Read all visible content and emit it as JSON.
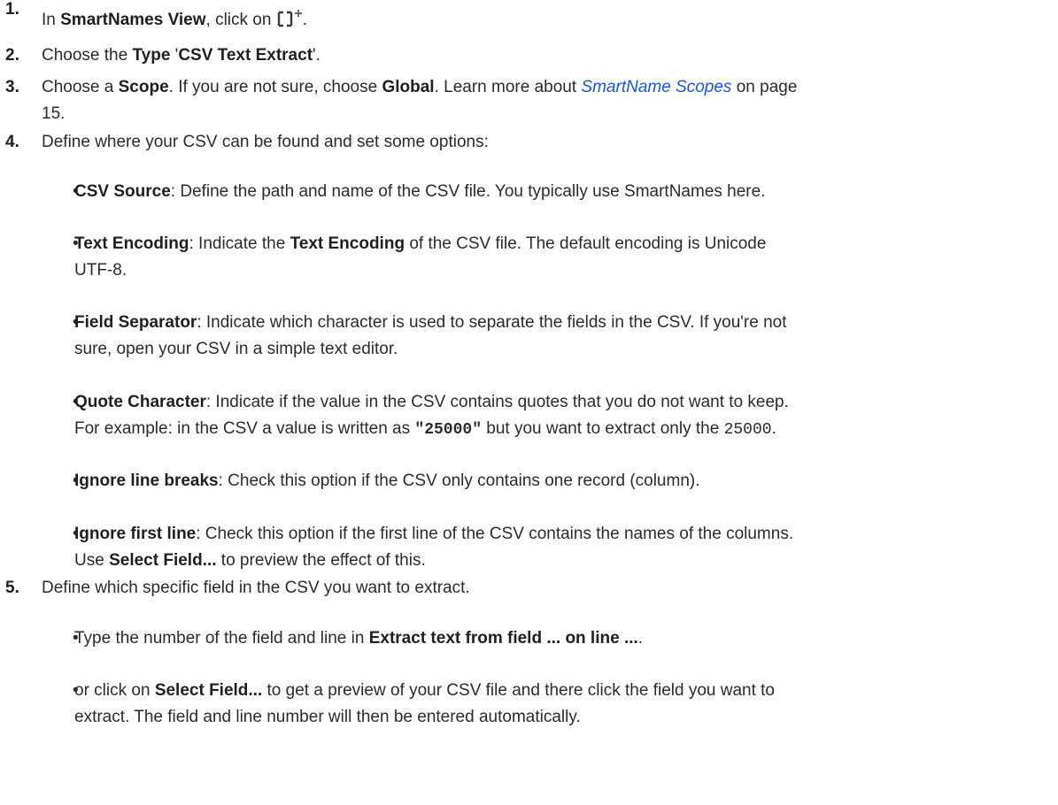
{
  "steps": [
    {
      "num": "1.",
      "parts": [
        "In ",
        "SmartNames View",
        ", click on ",
        "."
      ],
      "icon": "insert-smartname-icon"
    },
    {
      "num": "2.",
      "parts": [
        "Choose the ",
        "Type",
        " '",
        "CSV Text Extract",
        "'."
      ]
    },
    {
      "num": "3.",
      "line1": [
        "Choose a ",
        "Scope",
        ". If you are not sure, choose ",
        "Global",
        ". Learn more about ",
        "SmartName Scopes",
        " on page"
      ],
      "line2": "15."
    },
    {
      "num": "4.",
      "text": "Define where your CSV can be found and set some options:",
      "bullets": [
        {
          "label": "CSV Source",
          "text": ": Define the path and name of the CSV file. You typically use SmartNames here."
        },
        {
          "label": "Text Encoding",
          "text_a": ": Indicate the ",
          "bold_b": "Text Encoding",
          "text_c": " of the CSV file. The default encoding is Unicode",
          "line2": "UTF-8."
        },
        {
          "label": "Field Separator",
          "text": ": Indicate which character is used to separate the fields in the CSV. If you're not",
          "line2": "sure, open your CSV in a simple text editor."
        },
        {
          "label": "Quote Character",
          "text": ": Indicate if the value in the CSV contains quotes that you do not want to keep.",
          "line2_a": "For example: in the CSV a value is written as ",
          "code_quoted": "\"25000\"",
          "line2_b": " but you want to extract only the ",
          "code_plain": "25000",
          "line2_c": "."
        },
        {
          "label": "Ignore line breaks",
          "text": ": Check this option if the CSV only contains one record (column)."
        },
        {
          "label": "Ignore first line",
          "text": ": Check this option if the first line of the CSV contains the names of the columns.",
          "line2_a": "Use ",
          "line2_bold": "Select Field...",
          "line2_b": " to preview the effect of this."
        }
      ]
    },
    {
      "num": "5.",
      "text": "Define which specific field in the CSV you want to extract.",
      "bullets": [
        {
          "text_a": "Type the number of the field and line in ",
          "bold": "Extract text from field ... on line ...",
          "text_b": "."
        },
        {
          "text_a": "or click on ",
          "bold": "Select Field...",
          "text_b": " to get a preview of your CSV file and there click the field you want to",
          "line2": "extract. The field and line number will then be entered automatically."
        }
      ]
    }
  ],
  "bullet_glyph": "•",
  "colors": {
    "text": "#2b2b2b",
    "link": "#1a55d6"
  }
}
